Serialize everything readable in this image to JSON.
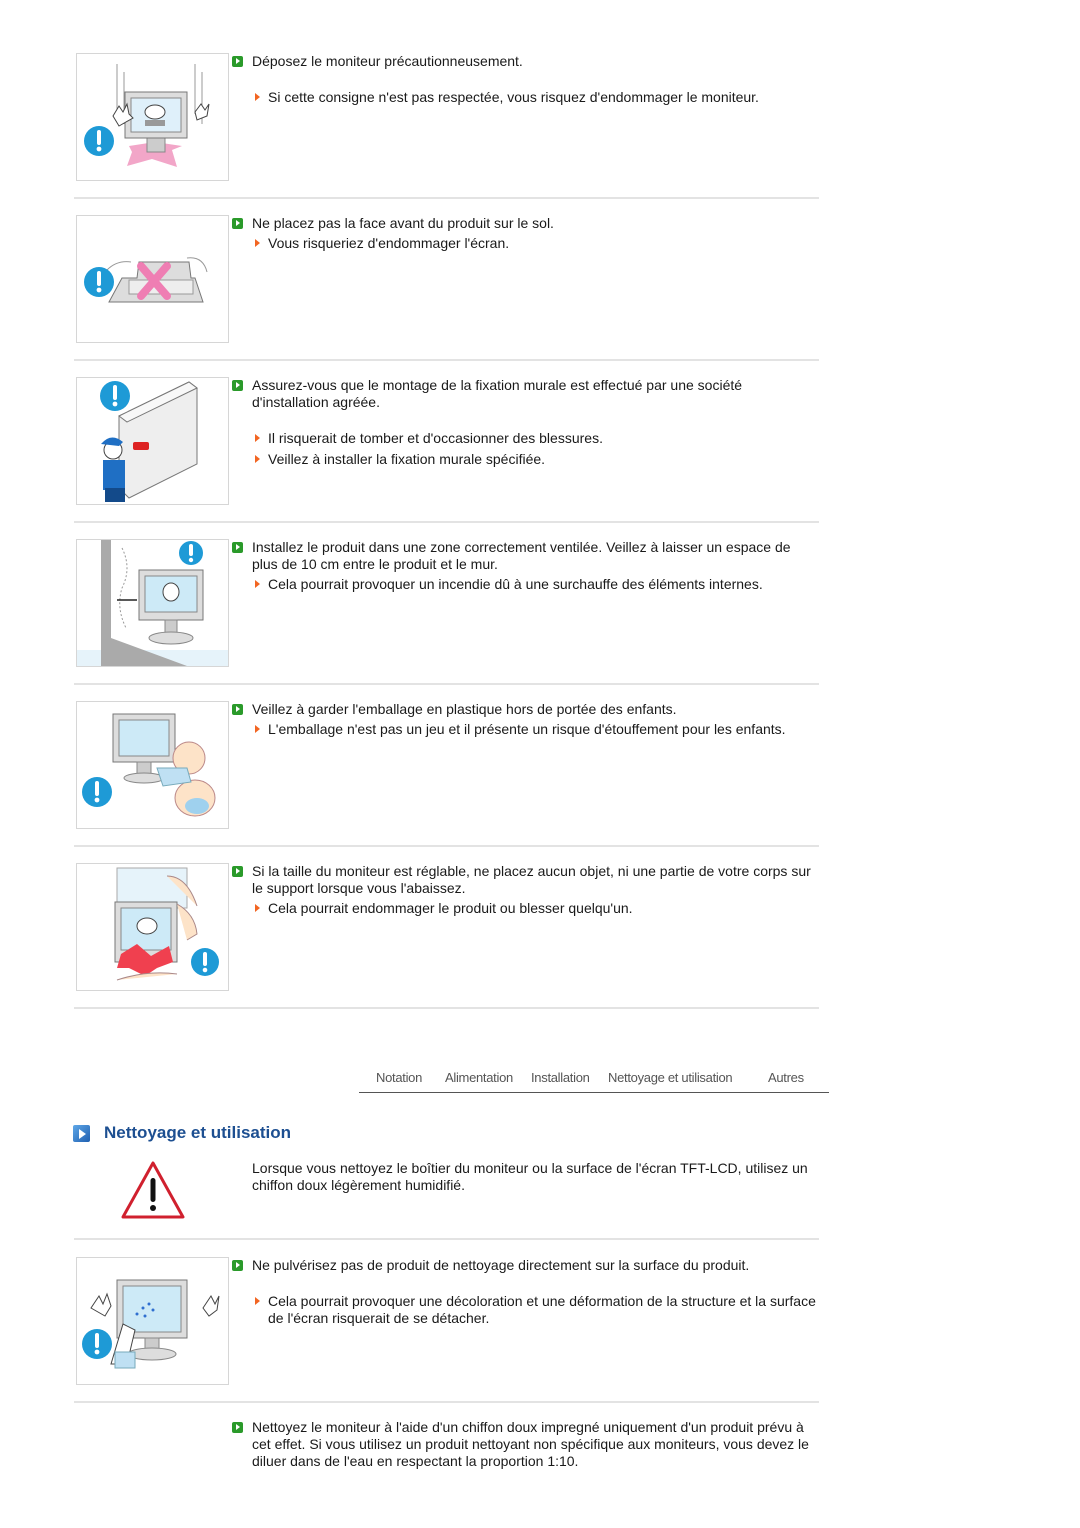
{
  "sections_top": [
    {
      "illustration": "monitor-dropped-warning",
      "main": "Déposez le moniteur précautionneusement.",
      "subs": [
        "Si cette consigne n'est pas respectée, vous risquez d'endommager le moniteur."
      ]
    },
    {
      "illustration": "monitor-face-down-warning",
      "main": "Ne placez pas la face avant du produit sur le sol.",
      "subs": [
        "Vous risqueriez d'endommager l'écran."
      ]
    },
    {
      "illustration": "wall-mount-installer-warning",
      "main": "Assurez-vous que le montage de la fixation murale est effectué par une société d'installation agréée.",
      "subs": [
        "Il risquerait de tomber et d'occasionner des blessures.",
        "Veillez à installer la fixation murale spécifiée."
      ]
    },
    {
      "illustration": "ventilation-distance-warning",
      "main": "Installez le produit dans une zone correctement ventilée. Veillez à laisser un espace de plus de 10 cm entre le produit et le mur.",
      "subs": [
        "Cela pourrait provoquer un incendie dû à une surchauffe des éléments internes."
      ]
    },
    {
      "illustration": "plastic-bag-child-warning",
      "main": "Veillez à garder l'emballage en plastique hors de portée des enfants.",
      "subs": [
        "L'emballage n'est pas un jeu et il présente un risque d'étouffement pour les enfants."
      ]
    },
    {
      "illustration": "height-adjust-pinch-warning",
      "main": "Si la taille du moniteur est réglable, ne placez aucun objet, ni une partie de votre corps sur le support lorsque vous l'abaissez.",
      "subs": [
        "Cela pourrait endommager le produit ou blesser quelqu'un."
      ]
    }
  ],
  "nav": {
    "items": [
      "Notation",
      "Alimentation",
      "Installation",
      "Nettoyage et utilisation",
      "Autres"
    ]
  },
  "cleaning": {
    "heading": "Nettoyage et utilisation",
    "intro": "Lorsque vous nettoyez le boîtier du moniteur ou la surface de l'écran TFT-LCD, utilisez un chiffon doux légèrement humidifié.",
    "intro_icon": "warning-triangle-icon",
    "items": [
      {
        "illustration": "spray-on-screen-warning",
        "main": "Ne pulvérisez pas de produit de nettoyage directement sur la surface du produit.",
        "subs": [
          "Cela pourrait provoquer une décoloration et une déformation de la structure et la surface de l'écran risquerait de se détacher."
        ]
      },
      {
        "main": "Nettoyez le moniteur à l'aide d'un chiffon doux impregné uniquement d'un produit prévu à cet effet. Si vous utilisez un produit nettoyant non spécifique aux moniteurs, vous devez le diluer dans de l'eau en respectant la proportion 1:10.",
        "subs": []
      }
    ]
  },
  "colors": {
    "heading": "#1d4f91",
    "bullet_main": "#2a9a2a",
    "bullet_sub": "#f26522",
    "warning_blue": "#1e9ad6",
    "warning_red": "#d0202e"
  }
}
